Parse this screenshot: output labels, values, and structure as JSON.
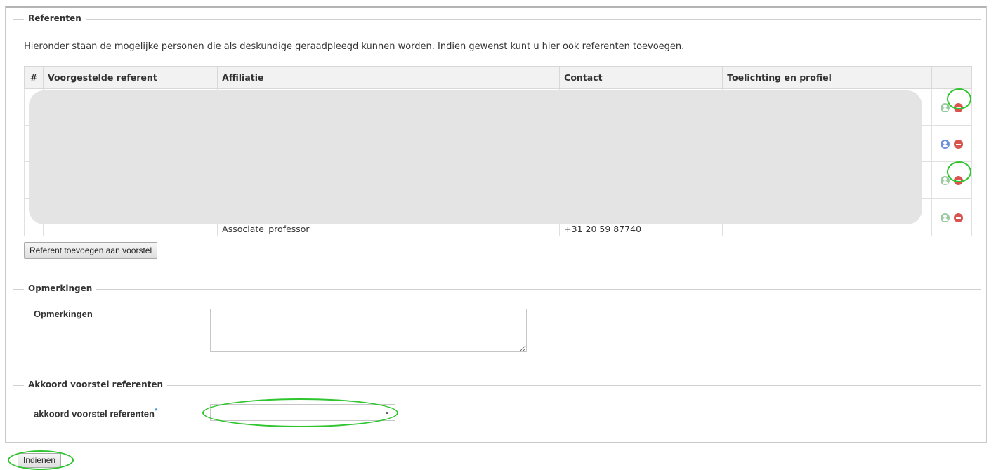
{
  "sections": {
    "referenten": "Referenten",
    "opmerkingen": "Opmerkingen",
    "akkoord": "Akkoord voorstel referenten"
  },
  "intro": "Hieronder staan de mogelijke personen die als deskundige geraadpleegd kunnen worden. Indien gewenst kunt u hier ook referenten toevoegen.",
  "table": {
    "headers": [
      "#",
      "Voorgestelde referent",
      "Affiliatie",
      "Contact",
      "Toelichting en profiel",
      ""
    ],
    "rows": [
      {
        "num": "",
        "referent": "",
        "affiliatie": "",
        "contact": "",
        "toelichting": "",
        "person_icon": "person-green-icon"
      },
      {
        "num": "",
        "referent": "",
        "affiliatie": "",
        "contact": "",
        "toelichting": "",
        "person_icon": "person-blue-icon"
      },
      {
        "num": "",
        "referent": "",
        "affiliatie": "",
        "contact": "",
        "toelichting": "",
        "person_icon": "person-green-icon"
      },
      {
        "num": "",
        "referent": "",
        "affiliatie": "Associate_professor",
        "contact": "+31 20 59 87740",
        "toelichting": "",
        "person_icon": "person-green-icon"
      }
    ]
  },
  "add_referent_label": "Referent toevoegen aan voorstel",
  "opmerkingen_label": "Opmerkingen",
  "opmerkingen_value": "",
  "akkoord_label": "akkoord voorstel referenten",
  "akkoord_required": "*",
  "akkoord_selected": "",
  "submit_label": "Indienen",
  "colors": {
    "highlight": "#2ec52e",
    "remove": "#d9534f",
    "person_green": "#9cc9a2",
    "person_blue": "#6e8fe0",
    "required": "#3b8fd6"
  }
}
